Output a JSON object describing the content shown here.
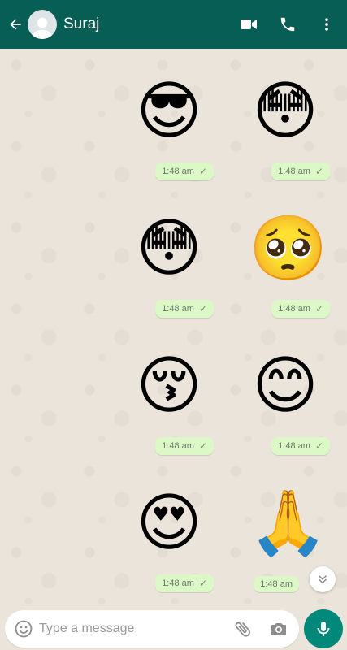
{
  "header": {
    "contact_name": "Suraj"
  },
  "icons": {
    "back": "arrow-left-icon",
    "video": "video-camera-icon",
    "call": "phone-icon",
    "menu": "more-vertical-icon",
    "emoji": "smiley-icon",
    "attach": "paperclip-icon",
    "camera": "camera-icon",
    "mic": "microphone-icon",
    "scroll": "chevron-double-down-icon"
  },
  "messages": [
    {
      "sticker": "😎",
      "time": "1:48 am",
      "tick": "✓"
    },
    {
      "sticker": "😳",
      "time": "1:48 am",
      "tick": "✓"
    },
    {
      "sticker": "😳",
      "time": "1:48 am",
      "tick": "✓"
    },
    {
      "sticker": "🥺",
      "time": "1:48 am",
      "tick": "✓"
    },
    {
      "sticker": "😚",
      "time": "1:48 am",
      "tick": "✓"
    },
    {
      "sticker": "😊",
      "time": "1:48 am",
      "tick": "✓"
    },
    {
      "sticker": "😍",
      "time": "1:48 am",
      "tick": "✓"
    },
    {
      "sticker": "🙏",
      "time": "1:48 am",
      "tick": ""
    }
  ],
  "composer": {
    "placeholder": "Type a message"
  },
  "colors": {
    "header": "#075e54",
    "bubble": "#dcf8c6",
    "fab": "#00897b"
  }
}
